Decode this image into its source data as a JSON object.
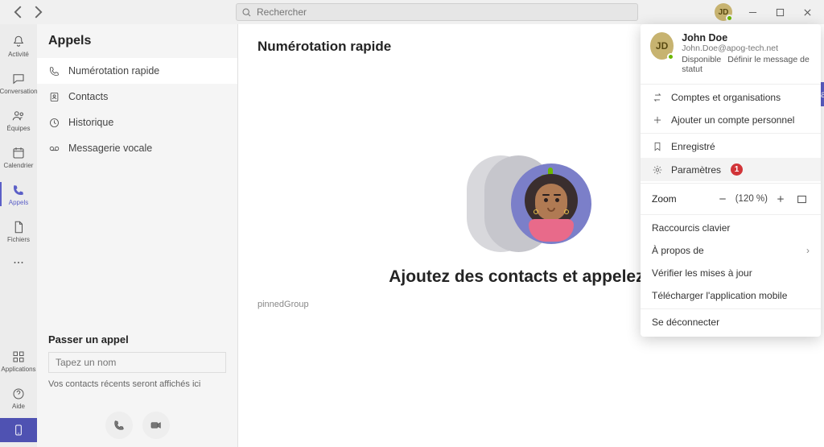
{
  "search": {
    "placeholder": "Rechercher"
  },
  "user": {
    "initials": "JD",
    "name": "John Doe",
    "email": "John.Doe@apog-tech.net",
    "status": "Disponible",
    "status_action": "Définir le message de statut"
  },
  "rail": {
    "items": [
      {
        "label": "Activité"
      },
      {
        "label": "Conversation"
      },
      {
        "label": "Équipes"
      },
      {
        "label": "Calendrier"
      },
      {
        "label": "Appels"
      },
      {
        "label": "Fichiers"
      }
    ],
    "apps": "Applications",
    "help": "Aide"
  },
  "sidepanel": {
    "title": "Appels",
    "items": [
      {
        "label": "Numérotation rapide"
      },
      {
        "label": "Contacts"
      },
      {
        "label": "Historique"
      },
      {
        "label": "Messagerie vocale"
      }
    ],
    "call_title": "Passer un appel",
    "call_placeholder": "Tapez un nom",
    "call_hint": "Vos contacts récents seront affichés ici"
  },
  "content": {
    "title": "Numérotation rapide",
    "add_button": "Ajouter à la",
    "hero_caption": "Ajoutez des contacts et appelez-les",
    "pinned": "pinnedGroup"
  },
  "menu": {
    "accounts": "Comptes et organisations",
    "add_account": "Ajouter un compte personnel",
    "saved": "Enregistré",
    "settings": "Paramètres",
    "settings_badge": "1",
    "zoom_label": "Zoom",
    "zoom_value": "(120 %)",
    "shortcuts": "Raccourcis clavier",
    "about": "À propos de",
    "updates": "Vérifier les mises à jour",
    "mobile": "Télécharger l'application mobile",
    "signout": "Se déconnecter"
  }
}
